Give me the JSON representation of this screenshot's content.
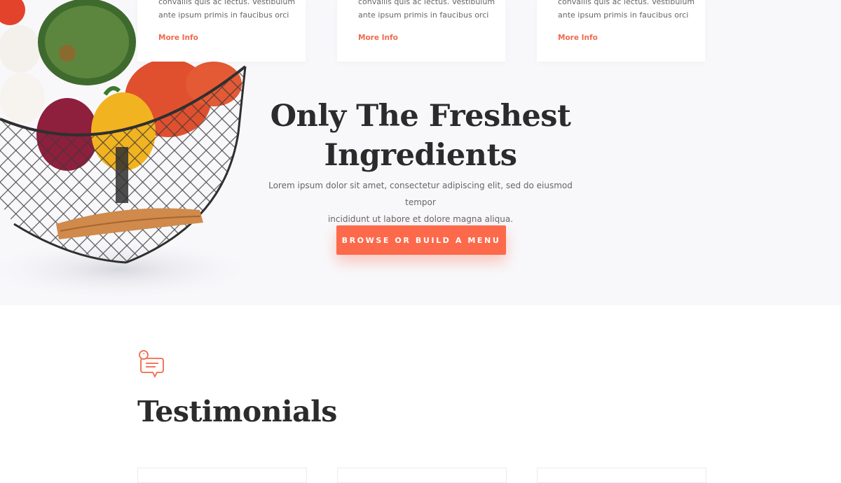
{
  "services": [
    {
      "text_lines": [
        "convallis quis ac lectus. Vestibulum",
        "ante ipsum primis in faucibus orci"
      ],
      "link": "More Info"
    },
    {
      "text_lines": [
        "convallis quis ac lectus. Vestibulum",
        "ante ipsum primis in faucibus orci"
      ],
      "link": "More Info"
    },
    {
      "text_lines": [
        "convallis quis ac lectus. Vestibulum",
        "ante ipsum primis in faucibus orci"
      ],
      "link": "More Info"
    }
  ],
  "hero": {
    "title_lines": [
      "Only The Freshest",
      "Ingredients"
    ],
    "description_lines": [
      "Lorem ipsum dolor sit amet, consectetur adipiscing elit, sed do eiusmod tempor",
      "incididunt ut labore et dolore magna aliqua."
    ],
    "cta_label": "BROWSE OR BUILD A MENU"
  },
  "testimonials": {
    "icon": "speech-bubble-icon",
    "title": "Testimonials"
  },
  "colors": {
    "accent": "#fd6a4b",
    "heading": "#2b2b2b",
    "hero_background": "#f8f8fb"
  }
}
